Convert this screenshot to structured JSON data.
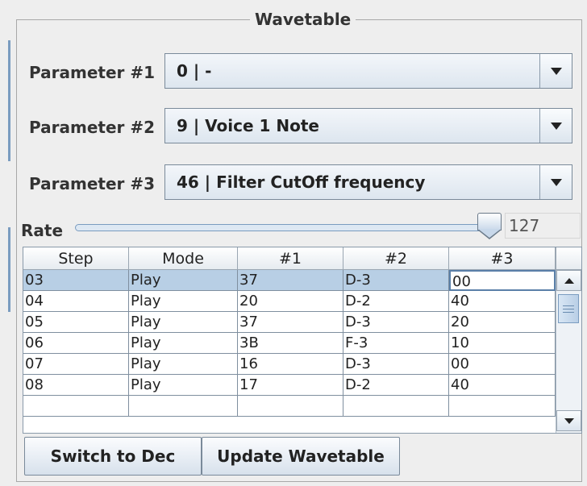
{
  "panel": {
    "title": "Wavetable"
  },
  "parameters": [
    {
      "label": "Parameter #1",
      "value": "0 | -"
    },
    {
      "label": "Parameter #2",
      "value": "9 | Voice 1 Note"
    },
    {
      "label": "Parameter #3",
      "value": "46 | Filter CutOff frequency"
    }
  ],
  "rate": {
    "label": "Rate",
    "value": "127",
    "max": 127
  },
  "table": {
    "columns": [
      "Step",
      "Mode",
      "#1",
      "#2",
      "#3"
    ],
    "rows": [
      [
        "03",
        "Play",
        "37",
        "D-3",
        "00"
      ],
      [
        "04",
        "Play",
        "20",
        "D-2",
        "40"
      ],
      [
        "05",
        "Play",
        "37",
        "D-3",
        "20"
      ],
      [
        "06",
        "Play",
        "3B",
        "F-3",
        "10"
      ],
      [
        "07",
        "Play",
        "16",
        "D-3",
        "00"
      ],
      [
        "08",
        "Play",
        "17",
        "D-2",
        "40"
      ]
    ],
    "selected_row": 0,
    "focused_column": 4
  },
  "buttons": {
    "switch_label": "Switch to Dec",
    "update_label": "Update Wavetable"
  },
  "icons": {
    "combo_arrow": "chevron-down-icon",
    "scroll_up": "arrow-up-icon",
    "scroll_down": "arrow-down-icon"
  }
}
